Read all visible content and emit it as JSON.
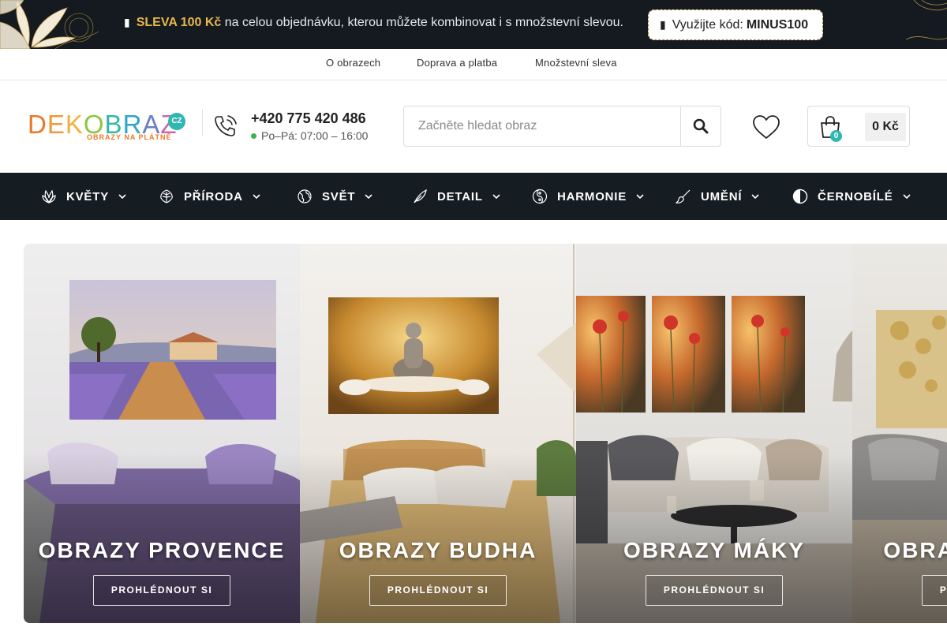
{
  "promo": {
    "gift_icon": "gift-icon",
    "highlight": "SLEVA 100 Kč",
    "text": " na celou objednávku, kterou můžete kombinovat i s množstevní slevou.",
    "code_label": "Využijte kód:",
    "code": "MINUS100",
    "highlight_color": "#e9b84a"
  },
  "toplinks": [
    "O obrazech",
    "Doprava a platba",
    "Množstevní sleva"
  ],
  "header": {
    "logo_text": "DEKOBRAZ",
    "logo_cz": "CZ",
    "logo_sub": "OBRAZY NA PLÁTNĚ",
    "phone": "+420 775 420 486",
    "hours": "Po–Pá: 07:00 – 16:00",
    "search_placeholder": "Začněte hledat obraz",
    "cart_count": "0",
    "cart_total": "0 Kč"
  },
  "nav": [
    {
      "label": "KVĚTY",
      "icon": "flower-icon"
    },
    {
      "label": "PŘÍRODA",
      "icon": "leaf-icon"
    },
    {
      "label": "SVĚT",
      "icon": "globe-icon"
    },
    {
      "label": "DETAIL",
      "icon": "feather-icon"
    },
    {
      "label": "HARMONIE",
      "icon": "yin-yang-icon"
    },
    {
      "label": "UMĚNÍ",
      "icon": "brush-icon"
    },
    {
      "label": "ČERNOBÍLÉ",
      "icon": "contrast-icon"
    }
  ],
  "cards": [
    {
      "title": "OBRAZY PROVENCE",
      "button": "PROHLÉDNOUT SI"
    },
    {
      "title": "OBRAZY BUDHA",
      "button": "PROHLÉDNOUT SI"
    },
    {
      "title": "OBRAZY MÁKY",
      "button": "PROHLÉDNOUT SI"
    },
    {
      "title": "OBRAZY STROMY",
      "button": "PROHLÉDNOUT SI"
    }
  ],
  "colors": {
    "dark": "#151c22",
    "accent": "#2fb7b2",
    "gold": "#e9b84a"
  }
}
